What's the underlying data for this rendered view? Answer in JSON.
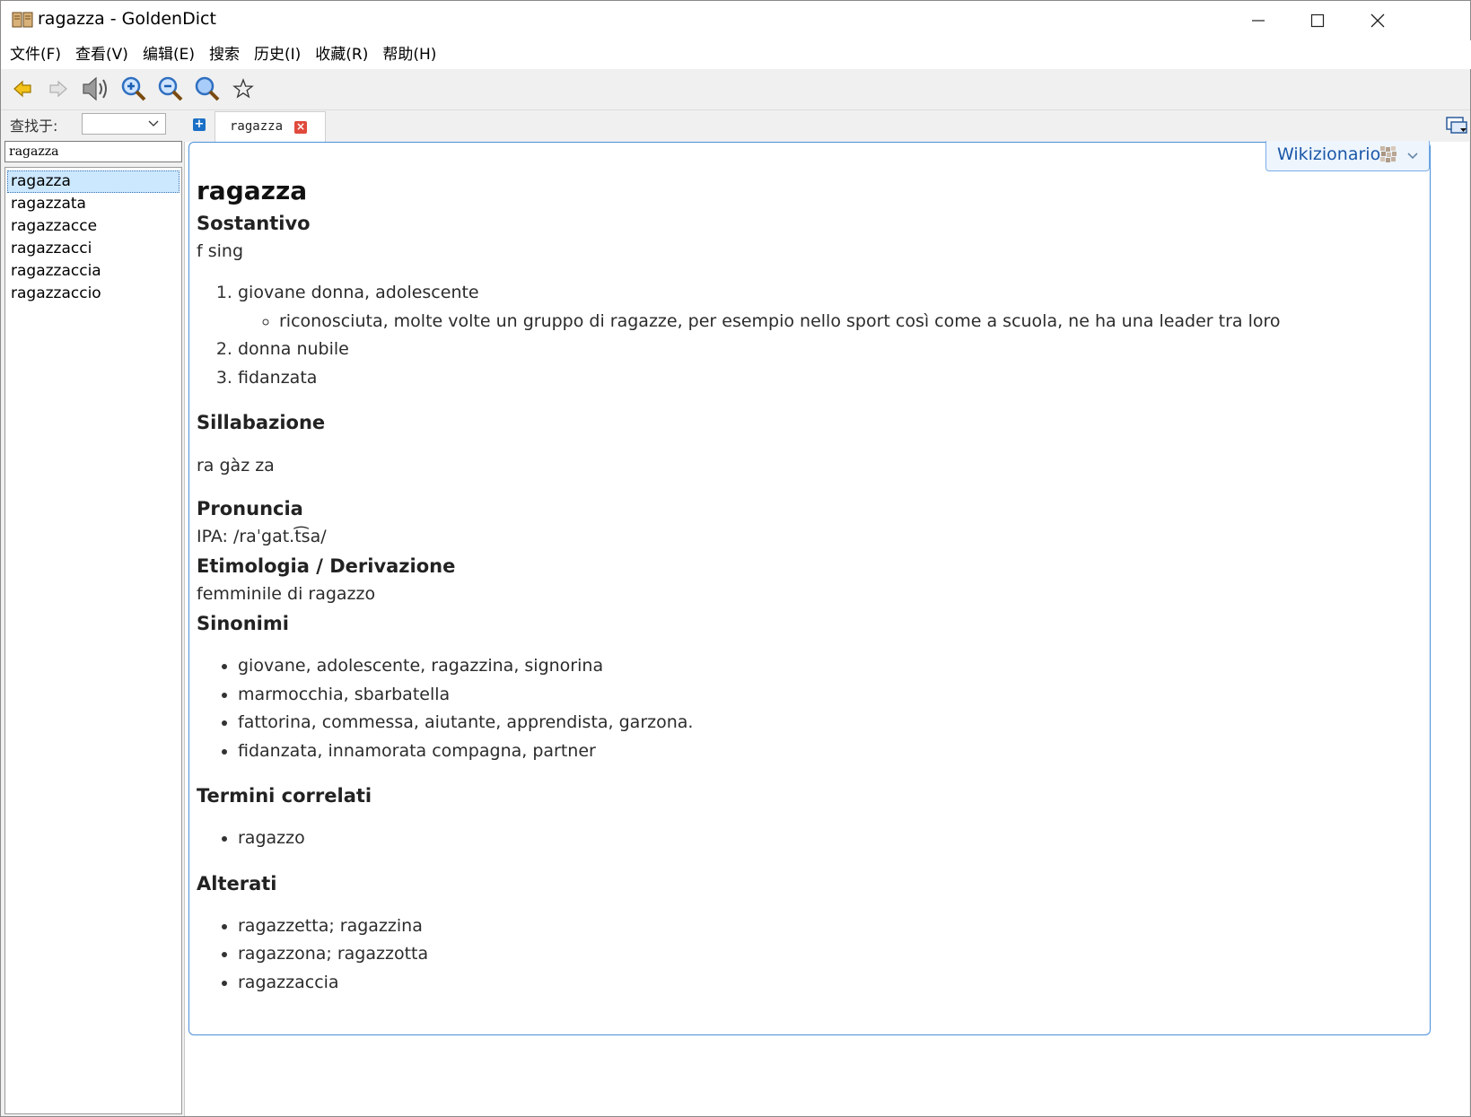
{
  "window": {
    "title": "ragazza - GoldenDict"
  },
  "menu": [
    "文件(F)",
    "查看(V)",
    "编辑(E)",
    "搜索",
    "历史(I)",
    "收藏(R)",
    "帮助(H)"
  ],
  "toolbar": [
    "back-arrow-icon",
    "forward-arrow-icon",
    "speaker-icon",
    "zoom-in-icon",
    "zoom-out-icon",
    "zoom-reset-icon",
    "star-icon"
  ],
  "left_panel": {
    "lookin_label": "查找于:",
    "lookin_value": "",
    "search_value": "ragazza",
    "words": [
      "ragazza",
      "ragazzata",
      "ragazzacce",
      "ragazzacci",
      "ragazzaccia",
      "ragazzaccio"
    ]
  },
  "tabs": [
    {
      "label": "ragazza"
    }
  ],
  "article": {
    "dictionary": "Wikizionario",
    "headword": "ragazza",
    "pos_heading": "Sostantivo",
    "pos_info": "f sing",
    "senses": [
      {
        "text": "giovane donna, adolescente",
        "sub": [
          "riconosciuta, molte volte un gruppo di ragazze, per esempio nello sport così come a scuola, ne ha una leader tra loro"
        ]
      },
      {
        "text": "donna nubile"
      },
      {
        "text": "fidanzata"
      }
    ],
    "sillabazione_heading": "Sillabazione",
    "sillabazione": "ra gàz za",
    "pronuncia_heading": "Pronuncia",
    "pronuncia": "IPA: /raˈgat.t͡sa/",
    "etimologia_heading": "Etimologia / Derivazione",
    "etimologia": "femminile di ragazzo",
    "sinonimi_heading": "Sinonimi",
    "sinonimi": [
      "giovane, adolescente, ragazzina, signorina",
      "marmocchia, sbarbatella",
      "fattorina, commessa, aiutante, apprendista, garzona.",
      "fidanzata, innamorata compagna, partner"
    ],
    "correlati_heading": "Termini correlati",
    "correlati": [
      "ragazzo"
    ],
    "alterati_heading": "Alterati",
    "alterati": [
      "ragazzetta; ragazzina",
      "ragazzona; ragazzotta",
      "ragazzaccia"
    ]
  }
}
